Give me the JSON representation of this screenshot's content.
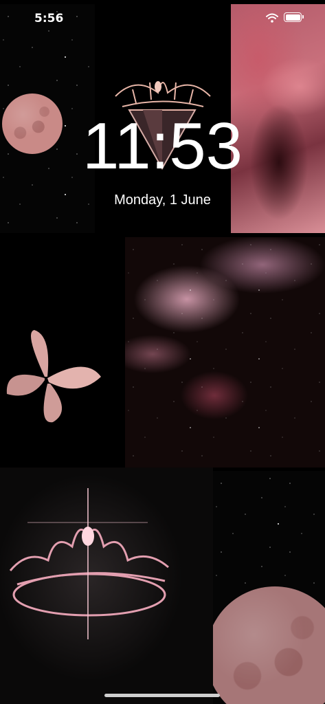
{
  "status_bar": {
    "time": "5:56",
    "icons": [
      "wifi-icon",
      "battery-icon"
    ]
  },
  "lock_screen": {
    "clock": "11:53",
    "date": "Monday, 1 June"
  },
  "wallpaper": {
    "tiles": [
      "starfield-moon",
      "crown-diamond",
      "nebula-top",
      "butterfly",
      "nebula-mid",
      "crown-bottom",
      "moon-bottom"
    ],
    "accent_color": "#d8a3a0"
  }
}
